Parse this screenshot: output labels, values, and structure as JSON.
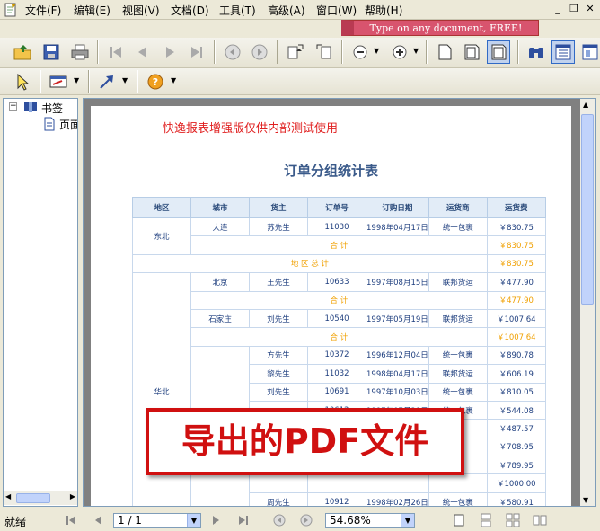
{
  "menus": [
    "文件(F)",
    "编辑(E)",
    "视图(V)",
    "文档(D)",
    "工具(T)",
    "高级(A)",
    "窗口(W)",
    "帮助(H)"
  ],
  "promo_text": "Type on any document, FREE!",
  "sidebar": {
    "bookmarks_label": "书签",
    "page_label": "页面"
  },
  "document": {
    "watermark": "快逸报表增强版仅供内部测试使用",
    "title": "订单分组统计表",
    "columns": [
      "地区",
      "城市",
      "货主",
      "订单号",
      "订购日期",
      "运货商",
      "运货费"
    ],
    "rows": [
      {
        "region": "东北",
        "city": "大连",
        "owner": "苏先生",
        "order": "11030",
        "date": "1998年04月17日",
        "shipper": "统一包裹",
        "fee": "￥830.75"
      },
      {
        "type": "city_total",
        "label": "合 计",
        "fee": "￥830.75"
      },
      {
        "type": "region_total",
        "label": "地 区 总 计",
        "fee": "￥830.75"
      },
      {
        "region": "华北",
        "city": "北京",
        "owner": "王先生",
        "order": "10633",
        "date": "1997年08月15日",
        "shipper": "联邦货运",
        "fee": "￥477.90"
      },
      {
        "type": "city_total",
        "label": "合 计",
        "fee": "￥477.90"
      },
      {
        "city": "石家庄",
        "owner": "刘先生",
        "order": "10540",
        "date": "1997年05月19日",
        "shipper": "联邦货运",
        "fee": "￥1007.64"
      },
      {
        "type": "city_total",
        "label": "合 计",
        "fee": "￥1007.64"
      },
      {
        "city": "",
        "owner": "方先生",
        "order": "10372",
        "date": "1996年12月04日",
        "shipper": "统一包裹",
        "fee": "￥890.78"
      },
      {
        "owner": "黎先生",
        "order": "11032",
        "date": "1998年04月17日",
        "shipper": "联邦货运",
        "fee": "￥606.19"
      },
      {
        "owner": "刘先生",
        "order": "10691",
        "date": "1997年10月03日",
        "shipper": "统一包裹",
        "fee": "￥810.05"
      },
      {
        "owner": "",
        "order": "10612",
        "date": "1997年07月28日",
        "shipper": "统一包裹",
        "fee": "￥544.08"
      },
      {
        "owner": "",
        "order": "",
        "date": "",
        "shipper": "",
        "fee": "￥487.57"
      },
      {
        "owner": "",
        "order": "",
        "date": "",
        "shipper": "",
        "fee": "￥708.95"
      },
      {
        "owner": "",
        "order": "",
        "date": "",
        "shipper": "",
        "fee": "￥789.95"
      },
      {
        "owner": "",
        "order": "",
        "date": "",
        "shipper": "",
        "fee": "￥1000.00"
      },
      {
        "owner": "周先生",
        "order": "10912",
        "date": "1998年02月26日",
        "shipper": "统一包裹",
        "fee": "￥580.91"
      }
    ]
  },
  "overlay_text": "导出的PDF文件",
  "status": {
    "ready": "就绪",
    "page": "1 / 1",
    "zoom": "54.68%"
  }
}
